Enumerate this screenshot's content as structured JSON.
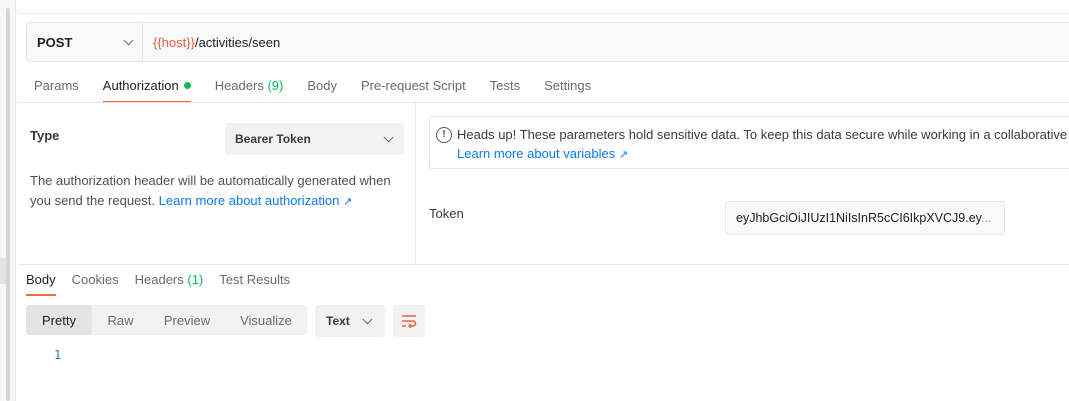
{
  "request": {
    "method": "POST",
    "url_variable": "{{host}}",
    "url_path": "/activities/seen"
  },
  "request_tabs": [
    {
      "label": "Params"
    },
    {
      "label": "Authorization",
      "active": true,
      "indicator": "green-dot"
    },
    {
      "label": "Headers",
      "count": "(9)"
    },
    {
      "label": "Body"
    },
    {
      "label": "Pre-request Script"
    },
    {
      "label": "Tests"
    },
    {
      "label": "Settings"
    }
  ],
  "auth": {
    "type_label": "Type",
    "type_value": "Bearer Token",
    "description": "The authorization header will be automatically generated when you send the request.",
    "learn_link": "Learn more about authorization",
    "link_arrow": "↗",
    "notice_text": "Heads up! These parameters hold sensitive data. To keep this data secure while working in a collaborative environment, we recommend using variables.",
    "notice_link": "Learn more about variables",
    "token_label": "Token",
    "token_value": "eyJhbGciOiJIUzI1NiIsInR5cCI6IkpXVCJ9.ey",
    "token_ellipsis": "..."
  },
  "response_tabs": [
    {
      "label": "Body",
      "active": true
    },
    {
      "label": "Cookies"
    },
    {
      "label": "Headers",
      "count": "(1)"
    },
    {
      "label": "Test Results"
    }
  ],
  "response": {
    "views": [
      "Pretty",
      "Raw",
      "Preview",
      "Visualize"
    ],
    "active_view": "Pretty",
    "format": "Text",
    "line_numbers": [
      "1"
    ]
  },
  "colors": {
    "accent": "#f26b3a",
    "success": "#0cbb52",
    "link": "#097bed",
    "variable": "#e8603c"
  },
  "icons": [
    "chevron-down-icon",
    "info-icon",
    "external-link-icon",
    "wrap-lines-icon"
  ]
}
